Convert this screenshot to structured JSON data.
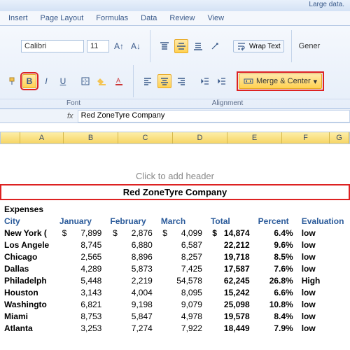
{
  "titlebar": {
    "filename": "Large data."
  },
  "tabs": [
    "Insert",
    "Page Layout",
    "Formulas",
    "Data",
    "Review",
    "View"
  ],
  "ribbon": {
    "font_name": "Calibri",
    "font_size": "11",
    "bold": "B",
    "italic": "I",
    "underline": "U",
    "wrap_text": "Wrap Text",
    "merge_center": "Merge & Center",
    "number_format": "Gener",
    "group_font": "Font",
    "group_align": "Alignment"
  },
  "fx": {
    "label": "fx",
    "value": "Red ZoneTyre Company"
  },
  "columns": [
    "A",
    "B",
    "C",
    "D",
    "E",
    "F",
    "G"
  ],
  "add_header": "Click to add header",
  "title": "Red ZoneTyre Company",
  "hdr_expenses": "Expenses",
  "headers": {
    "city": "City",
    "jan": "January",
    "feb": "February",
    "mar": "March",
    "total": "Total",
    "pct": "Percent",
    "eval": "Evaluation"
  },
  "rows": [
    {
      "city": "New York (",
      "jan": "7,899",
      "jan_pre": "$",
      "feb": "2,876",
      "feb_pre": "$",
      "mar": "4,099",
      "mar_pre": "$",
      "tot": "14,874",
      "tot_pre": "$",
      "pct": "6.4%",
      "ev": "low"
    },
    {
      "city": "Los Angele",
      "jan": "8,745",
      "feb": "6,880",
      "mar": "6,587",
      "tot": "22,212",
      "pct": "9.6%",
      "ev": "low"
    },
    {
      "city": "Chicago",
      "jan": "2,565",
      "feb": "8,896",
      "mar": "8,257",
      "tot": "19,718",
      "pct": "8.5%",
      "ev": "low"
    },
    {
      "city": "Dallas",
      "jan": "4,289",
      "feb": "5,873",
      "mar": "7,425",
      "tot": "17,587",
      "pct": "7.6%",
      "ev": "low"
    },
    {
      "city": "Philadelph",
      "jan": "5,448",
      "feb": "2,219",
      "mar": "54,578",
      "tot": "62,245",
      "pct": "26.8%",
      "ev": "High"
    },
    {
      "city": "Houston",
      "jan": "3,143",
      "feb": "4,004",
      "mar": "8,095",
      "tot": "15,242",
      "pct": "6.6%",
      "ev": "low"
    },
    {
      "city": "Washingto",
      "jan": "6,821",
      "feb": "9,198",
      "mar": "9,079",
      "tot": "25,098",
      "pct": "10.8%",
      "ev": "low"
    },
    {
      "city": "Miami",
      "jan": "8,753",
      "feb": "5,847",
      "mar": "4,978",
      "tot": "19,578",
      "pct": "8.4%",
      "ev": "low"
    },
    {
      "city": "Atlanta",
      "jan": "3,253",
      "feb": "7,274",
      "mar": "7,922",
      "tot": "18,449",
      "pct": "7.9%",
      "ev": "low"
    }
  ]
}
